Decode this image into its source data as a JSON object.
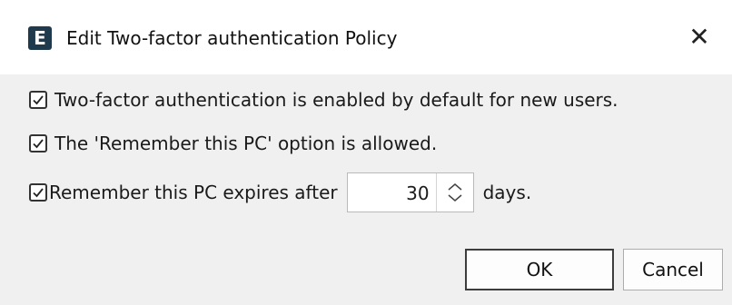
{
  "window": {
    "app_icon_letter": "E",
    "title": "Edit Two-factor authentication Policy",
    "close_glyph": "✕"
  },
  "options": {
    "two_factor_default": {
      "label": "Two-factor authentication is enabled by default for new users.",
      "checked": true
    },
    "remember_pc_allowed": {
      "label": "The 'Remember this PC' option is allowed.",
      "checked": true
    },
    "remember_pc_expires": {
      "label": "Remember this PC expires after",
      "checked": true,
      "value": "30",
      "unit": "days."
    }
  },
  "buttons": {
    "ok": "OK",
    "cancel": "Cancel"
  },
  "icons": {
    "app": "app-logo-icon",
    "close": "close-icon",
    "check": "checkmark-icon",
    "spinner": "chevron-updown-icon"
  },
  "colors": {
    "titlebar": "#ffffff",
    "body": "#f0f0f0",
    "app_icon": "#1e3a4c"
  }
}
